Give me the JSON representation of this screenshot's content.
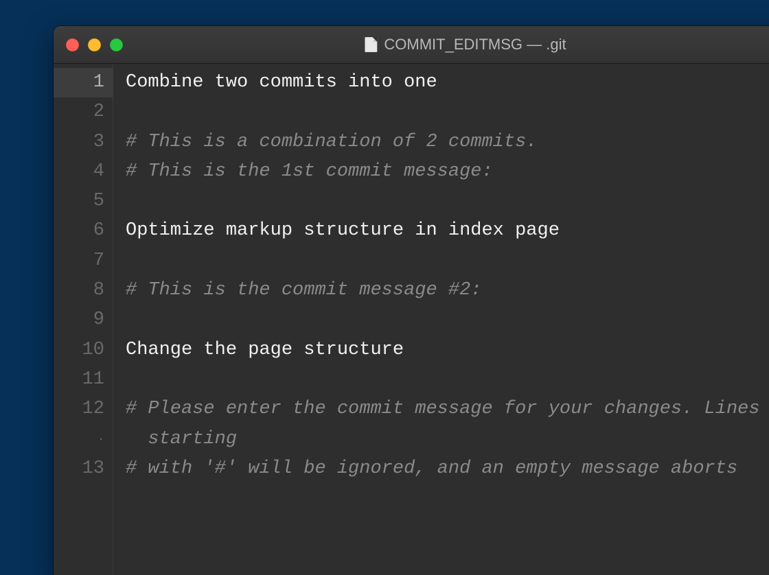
{
  "window": {
    "title": "COMMIT_EDITMSG — .git",
    "icon": "file-icon"
  },
  "editor": {
    "gutter": [
      "1",
      "2",
      "3",
      "4",
      "5",
      "6",
      "7",
      "8",
      "9",
      "10",
      "11",
      "12",
      "·",
      "13"
    ],
    "active_line_index": 0,
    "wrap_marker_index": 12,
    "lines": [
      {
        "text": "Combine two commits into one",
        "cls": "plain"
      },
      {
        "text": "",
        "cls": "plain"
      },
      {
        "text": "# This is a combination of 2 commits.",
        "cls": "comment"
      },
      {
        "text": "# This is the 1st commit message:",
        "cls": "comment"
      },
      {
        "text": "",
        "cls": "plain"
      },
      {
        "text": "Optimize markup structure in index page",
        "cls": "plain"
      },
      {
        "text": "",
        "cls": "plain"
      },
      {
        "text": "# This is the commit message #2:",
        "cls": "comment"
      },
      {
        "text": "",
        "cls": "plain"
      },
      {
        "text": "Change the page structure",
        "cls": "plain"
      },
      {
        "text": "",
        "cls": "plain"
      },
      {
        "text": "# Please enter the commit message for your changes. Lines",
        "cls": "comment"
      },
      {
        "text": "  starting",
        "cls": "comment"
      },
      {
        "text": "# with '#' will be ignored, and an empty message aborts",
        "cls": "comment"
      }
    ]
  }
}
